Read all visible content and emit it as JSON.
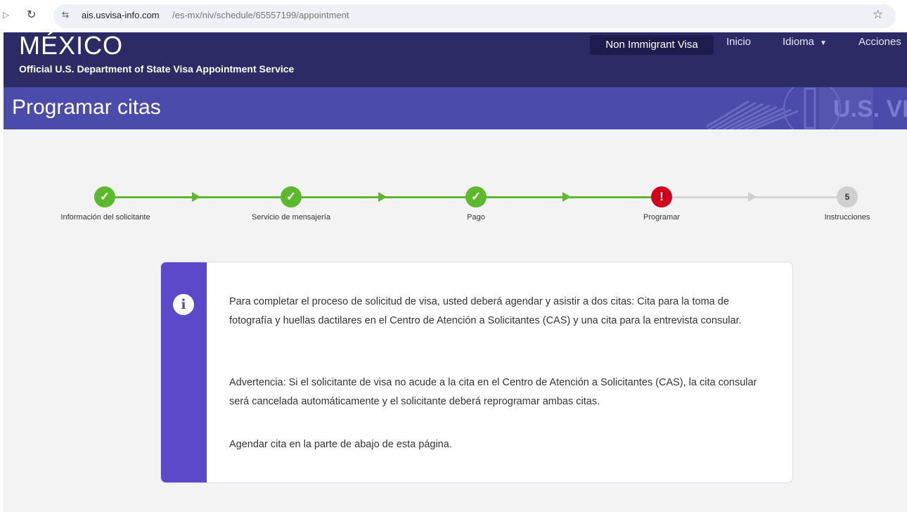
{
  "browser": {
    "url_host": "ais.usvisa-info.com",
    "url_path": "/es-mx/niv/schedule/65557199/appointment"
  },
  "header": {
    "country": "MÉXICO",
    "department": "Official U.S. Department of State Visa Appointment Service",
    "nav": {
      "non_immigrant_visa": "Non Immigrant Visa",
      "inicio": "Inicio",
      "idioma": "Idioma",
      "acciones": "Acciones"
    }
  },
  "banner": {
    "title": "Programar citas",
    "watermark": "U.S. VISA"
  },
  "stepper": {
    "steps": [
      {
        "label": "Información del solicitante",
        "status": "done"
      },
      {
        "label": "Servicio de mensajería",
        "status": "done"
      },
      {
        "label": "Pago",
        "status": "done"
      },
      {
        "label": "Programar",
        "status": "error"
      },
      {
        "label": "Instrucciones",
        "status": "pending",
        "number": "5"
      }
    ]
  },
  "info": {
    "paragraph1": "Para completar el proceso de solicitud de visa, usted deberá agendar y asistir a dos citas: Cita para la toma de fotografía y huellas dactilares en el Centro de Atención a Solicitantes (CAS) y una cita para la entrevista consular.",
    "paragraph2": "Advertencia: Si el solicitante de visa no acude a la cita en el Centro de Atención a Solicitantes (CAS), la cita consular será cancelada automáticamente y el solicitante deberá reprogramar ambas citas.",
    "paragraph3": "Agendar cita en la parte de abajo de esta página."
  },
  "colors": {
    "header_bg": "#2c2b66",
    "banner_bg": "#4b4bab",
    "step_done": "#5cb82c",
    "step_error": "#d0021b",
    "info_accent": "#5b49c9"
  }
}
